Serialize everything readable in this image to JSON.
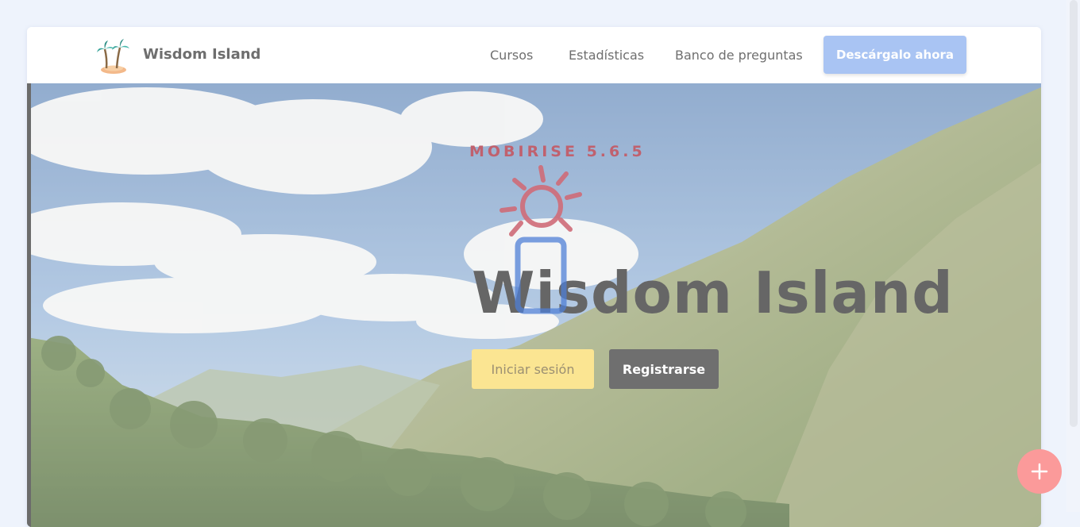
{
  "navbar": {
    "brand": "Wisdom Island",
    "links": [
      "Cursos",
      "Estadísticas",
      "Banco de preguntas"
    ],
    "cta": "Descárgalo ahora"
  },
  "hero": {
    "engine_label": "MOBIRISE 5.6.5",
    "title": "Wisdom Island",
    "login_button": "Iniciar sesión",
    "register_button": "Registrarse"
  },
  "icons": {
    "brand": "palm-tree-island-icon",
    "sun": "sun-icon",
    "phone": "mobile-phone-icon",
    "fab": "plus-icon"
  },
  "colors": {
    "cta": "#a9c4f3",
    "login": "#fbe592",
    "register": "#6f6f6f",
    "fab": "#fb9a9a",
    "engine_label": "#c0616e",
    "phone": "#4f7fd6"
  }
}
